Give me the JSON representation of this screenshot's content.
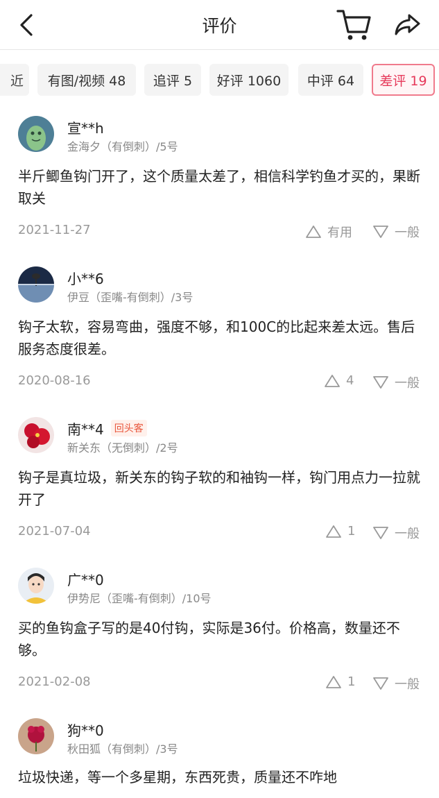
{
  "header": {
    "title": "评价"
  },
  "filters": [
    {
      "label": "近"
    },
    {
      "label": "有图/视频 48"
    },
    {
      "label": "追评 5"
    },
    {
      "label": "好评 1060"
    },
    {
      "label": "中评 64"
    },
    {
      "label": "差评 19",
      "active": true
    }
  ],
  "colors": {
    "accent": "#e6395a",
    "muted": "#999999"
  },
  "reviews": [
    {
      "user": "宣**h",
      "spec": "金海夕（有倒刺）/5号",
      "content": "半斤鲫鱼钩门开了，这个质量太差了，相信科学钓鱼才买的，果断取关",
      "date": "2021-11-27",
      "like": "有用",
      "dislike": "一般"
    },
    {
      "user": "小**6",
      "spec": "伊豆（歪嘴-有倒刺）/3号",
      "content": "钩子太软，容易弯曲，强度不够，和100C的比起来差太远。售后服务态度很差。",
      "date": "2020-08-16",
      "like": "4",
      "dislike": "一般"
    },
    {
      "user": "南**4",
      "badge": "回头客",
      "spec": "新关东（无倒刺）/2号",
      "content": "钩子是真垃圾，新关东的钩子软的和袖钩一样，钩门用点力一拉就开了",
      "date": "2021-07-04",
      "like": "1",
      "dislike": "一般"
    },
    {
      "user": "广**0",
      "spec": "伊势尼（歪嘴-有倒刺）/10号",
      "content": "买的鱼钩盒子写的是40付钩，实际是36付。价格高，数量还不够。",
      "date": "2021-02-08",
      "like": "1",
      "dislike": "一般"
    },
    {
      "user": "狗**0",
      "spec": "秋田狐（有倒刺）/3号",
      "content": "垃圾快递，等一个多星期，东西死贵，质量还不咋地"
    }
  ]
}
